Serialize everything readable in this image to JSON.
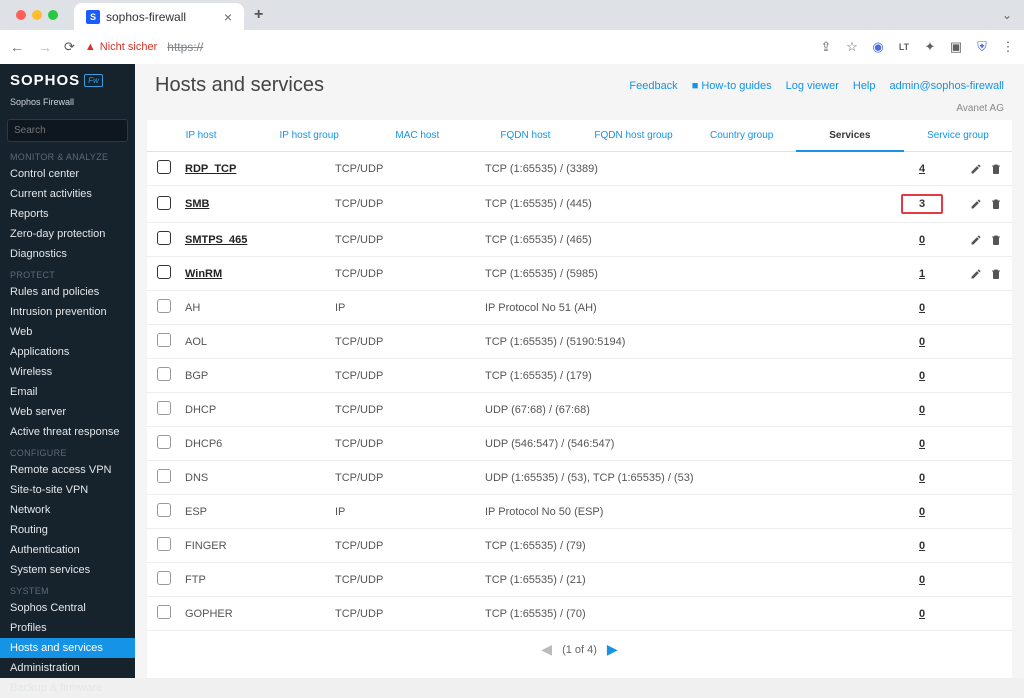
{
  "browser": {
    "tab_title": "sophos-firewall",
    "insecure_label": "Nicht sicher",
    "url_prefix": "https://",
    "favicon_letter": "S"
  },
  "brand": {
    "name": "SOPHOS",
    "badge": "Fw",
    "sub": "Sophos Firewall"
  },
  "search": {
    "placeholder": "Search"
  },
  "sidebar": {
    "sections": [
      {
        "label": "MONITOR & ANALYZE",
        "items": [
          "Control center",
          "Current activities",
          "Reports",
          "Zero-day protection",
          "Diagnostics"
        ]
      },
      {
        "label": "PROTECT",
        "items": [
          "Rules and policies",
          "Intrusion prevention",
          "Web",
          "Applications",
          "Wireless",
          "Email",
          "Web server",
          "Active threat response"
        ]
      },
      {
        "label": "CONFIGURE",
        "items": [
          "Remote access VPN",
          "Site-to-site VPN",
          "Network",
          "Routing",
          "Authentication",
          "System services"
        ]
      },
      {
        "label": "SYSTEM",
        "items": [
          "Sophos Central",
          "Profiles",
          "Hosts and services",
          "Administration",
          "Backup & firmware"
        ]
      }
    ],
    "active": "Hosts and services"
  },
  "header": {
    "title": "Hosts and services",
    "links": {
      "feedback": "Feedback",
      "howto": "How-to guides",
      "logviewer": "Log viewer",
      "help": "Help"
    },
    "user": "admin@sophos-firewall",
    "org": "Avanet AG"
  },
  "tabs": [
    "IP host",
    "IP host group",
    "MAC host",
    "FQDN host",
    "FQDN host group",
    "Country group",
    "Services",
    "Service group"
  ],
  "active_tab": "Services",
  "rows": [
    {
      "custom": true,
      "name": "RDP_TCP",
      "proto": "TCP/UDP",
      "details": "TCP (1:65535) / (3389)",
      "count": "4",
      "highlight": false
    },
    {
      "custom": true,
      "name": "SMB",
      "proto": "TCP/UDP",
      "details": "TCP (1:65535) / (445)",
      "count": "3",
      "highlight": true
    },
    {
      "custom": true,
      "name": "SMTPS_465",
      "proto": "TCP/UDP",
      "details": "TCP (1:65535) / (465)",
      "count": "0",
      "highlight": false
    },
    {
      "custom": true,
      "name": "WinRM",
      "proto": "TCP/UDP",
      "details": "TCP (1:65535) / (5985)",
      "count": "1",
      "highlight": false
    },
    {
      "custom": false,
      "name": "AH",
      "proto": "IP",
      "details": "IP Protocol No 51 (AH)",
      "count": "0",
      "highlight": false
    },
    {
      "custom": false,
      "name": "AOL",
      "proto": "TCP/UDP",
      "details": "TCP (1:65535) / (5190:5194)",
      "count": "0",
      "highlight": false
    },
    {
      "custom": false,
      "name": "BGP",
      "proto": "TCP/UDP",
      "details": "TCP (1:65535) / (179)",
      "count": "0",
      "highlight": false
    },
    {
      "custom": false,
      "name": "DHCP",
      "proto": "TCP/UDP",
      "details": "UDP (67:68) / (67:68)",
      "count": "0",
      "highlight": false
    },
    {
      "custom": false,
      "name": "DHCP6",
      "proto": "TCP/UDP",
      "details": "UDP (546:547) / (546:547)",
      "count": "0",
      "highlight": false
    },
    {
      "custom": false,
      "name": "DNS",
      "proto": "TCP/UDP",
      "details": "UDP (1:65535) / (53), TCP (1:65535) / (53)",
      "count": "0",
      "highlight": false
    },
    {
      "custom": false,
      "name": "ESP",
      "proto": "IP",
      "details": "IP Protocol No 50 (ESP)",
      "count": "0",
      "highlight": false
    },
    {
      "custom": false,
      "name": "FINGER",
      "proto": "TCP/UDP",
      "details": "TCP (1:65535) / (79)",
      "count": "0",
      "highlight": false
    },
    {
      "custom": false,
      "name": "FTP",
      "proto": "TCP/UDP",
      "details": "TCP (1:65535) / (21)",
      "count": "0",
      "highlight": false
    },
    {
      "custom": false,
      "name": "GOPHER",
      "proto": "TCP/UDP",
      "details": "TCP (1:65535) / (70)",
      "count": "0",
      "highlight": false
    }
  ],
  "pager": {
    "label": "(1 of 4)"
  }
}
